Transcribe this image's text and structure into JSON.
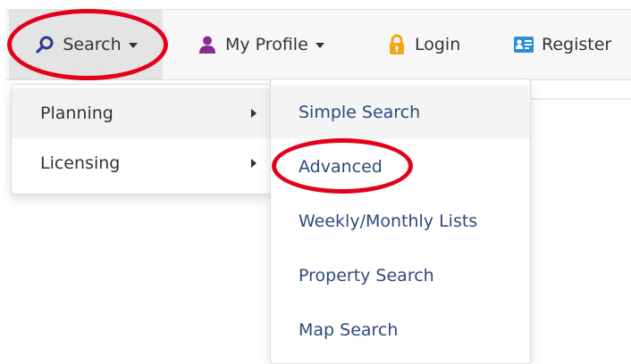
{
  "navbar": {
    "search_label": "Search",
    "profile_label": "My Profile",
    "login_label": "Login",
    "register_label": "Register",
    "icons": {
      "search": "search-icon",
      "profile": "user-icon",
      "login": "lock-icon",
      "register": "register-card-icon"
    }
  },
  "search_menu": {
    "items": [
      {
        "label": "Planning"
      },
      {
        "label": "Licensing"
      }
    ]
  },
  "planning_submenu": {
    "items": [
      {
        "label": "Simple Search"
      },
      {
        "label": "Advanced"
      },
      {
        "label": "Weekly/Monthly Lists"
      },
      {
        "label": "Property Search"
      },
      {
        "label": "Map Search"
      }
    ]
  },
  "colors": {
    "search_icon": "#2b3a8f",
    "profile_icon": "#8a2b8f",
    "login_icon": "#f0a81a",
    "register_icon": "#2a8fd8",
    "submenu_link": "#2d4a7a",
    "annotation": "#e3001b"
  }
}
